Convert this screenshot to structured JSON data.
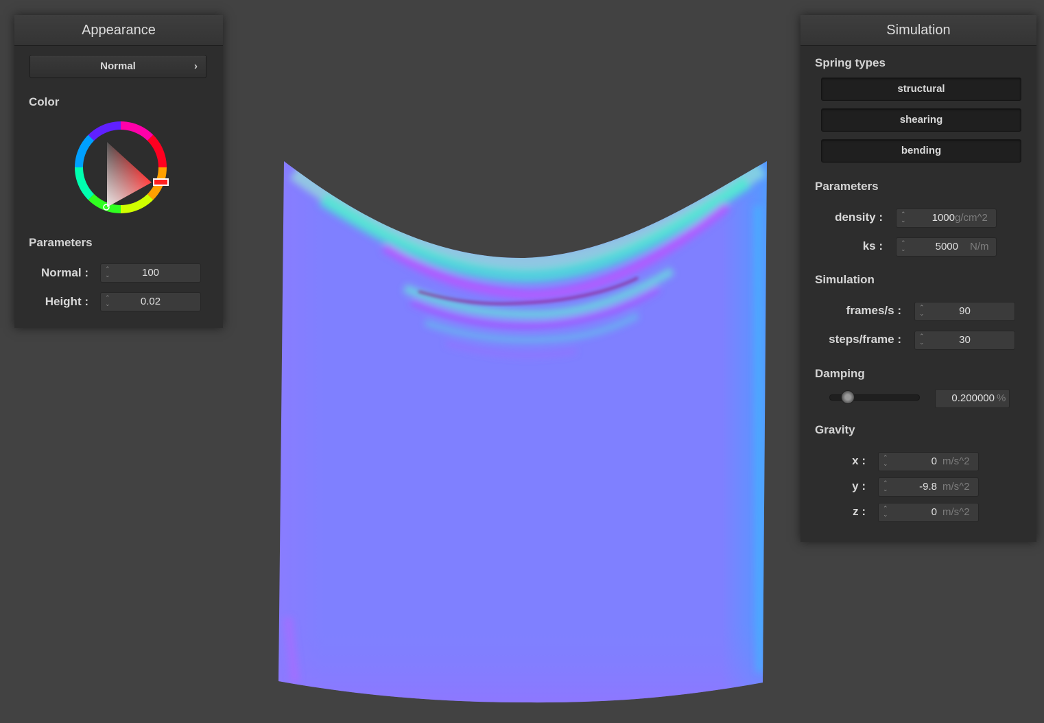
{
  "appearance": {
    "title": "Appearance",
    "shader_select": "Normal",
    "color_label": "Color",
    "parameters_label": "Parameters",
    "params": [
      {
        "label": "Normal :",
        "value": "100"
      },
      {
        "label": "Height :",
        "value": "0.02"
      }
    ]
  },
  "simulation": {
    "title": "Simulation",
    "spring_types_label": "Spring types",
    "spring_types": [
      "structural",
      "shearing",
      "bending"
    ],
    "parameters_label": "Parameters",
    "density": {
      "label": "density :",
      "value": "1000",
      "unit": "g/cm^2"
    },
    "ks": {
      "label": "ks :",
      "value": "5000",
      "unit": "N/m"
    },
    "simulation_label": "Simulation",
    "frames": {
      "label": "frames/s :",
      "value": "90"
    },
    "steps": {
      "label": "steps/frame :",
      "value": "30"
    },
    "damping_label": "Damping",
    "damping": {
      "value": "0.200000",
      "unit": "%",
      "level": 0.2
    },
    "gravity_label": "Gravity",
    "gravity": [
      {
        "label": "x :",
        "value": "0",
        "unit": "m/s^2"
      },
      {
        "label": "y :",
        "value": "-9.8",
        "unit": "m/s^2"
      },
      {
        "label": "z :",
        "value": "0",
        "unit": "m/s^2"
      }
    ]
  },
  "colors": {
    "background": "#424242",
    "panel": "#2d2d2d",
    "selected_color": "#ff0000",
    "cloth_base": "#7f80ff"
  }
}
